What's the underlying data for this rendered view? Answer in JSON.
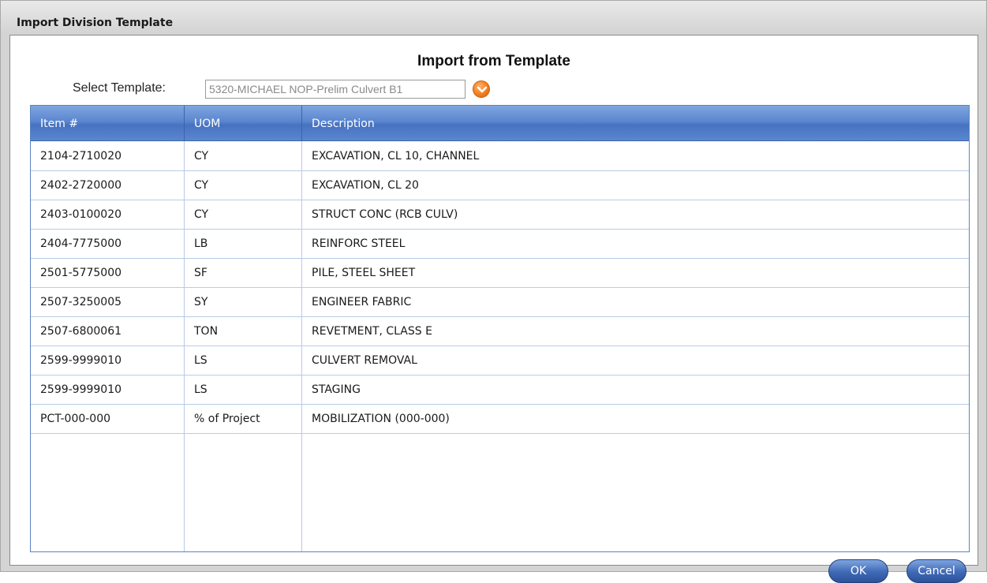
{
  "window": {
    "title": "Import Division Template"
  },
  "panel": {
    "heading": "Import from Template",
    "select_label": "Select Template:",
    "select_value": "5320-MICHAEL NOP-Prelim Culvert B1"
  },
  "grid": {
    "columns": [
      "Item #",
      "UOM",
      "Description"
    ],
    "rows": [
      {
        "item": "2104-2710020",
        "uom": "CY",
        "description": "EXCAVATION, CL 10, CHANNEL"
      },
      {
        "item": "2402-2720000",
        "uom": "CY",
        "description": "EXCAVATION, CL 20"
      },
      {
        "item": "2403-0100020",
        "uom": "CY",
        "description": "STRUCT CONC (RCB CULV)"
      },
      {
        "item": "2404-7775000",
        "uom": "LB",
        "description": "REINFORC STEEL"
      },
      {
        "item": "2501-5775000",
        "uom": "SF",
        "description": "PILE, STEEL SHEET"
      },
      {
        "item": "2507-3250005",
        "uom": "SY",
        "description": "ENGINEER FABRIC"
      },
      {
        "item": "2507-6800061",
        "uom": "TON",
        "description": "REVETMENT, CLASS E"
      },
      {
        "item": "2599-9999010",
        "uom": "LS",
        "description": "CULVERT REMOVAL"
      },
      {
        "item": "2599-9999010",
        "uom": "LS",
        "description": "STAGING"
      },
      {
        "item": "PCT-000-000",
        "uom": "% of Project",
        "description": "MOBILIZATION (000-000)"
      }
    ]
  },
  "buttons": {
    "ok": "OK",
    "cancel": "Cancel"
  },
  "colors": {
    "header_blue": "#4672c1",
    "accent_orange": "#f07a1a",
    "grid_line": "#b8cbe8"
  },
  "icons": {
    "dropdown": "chevron-down-icon"
  }
}
